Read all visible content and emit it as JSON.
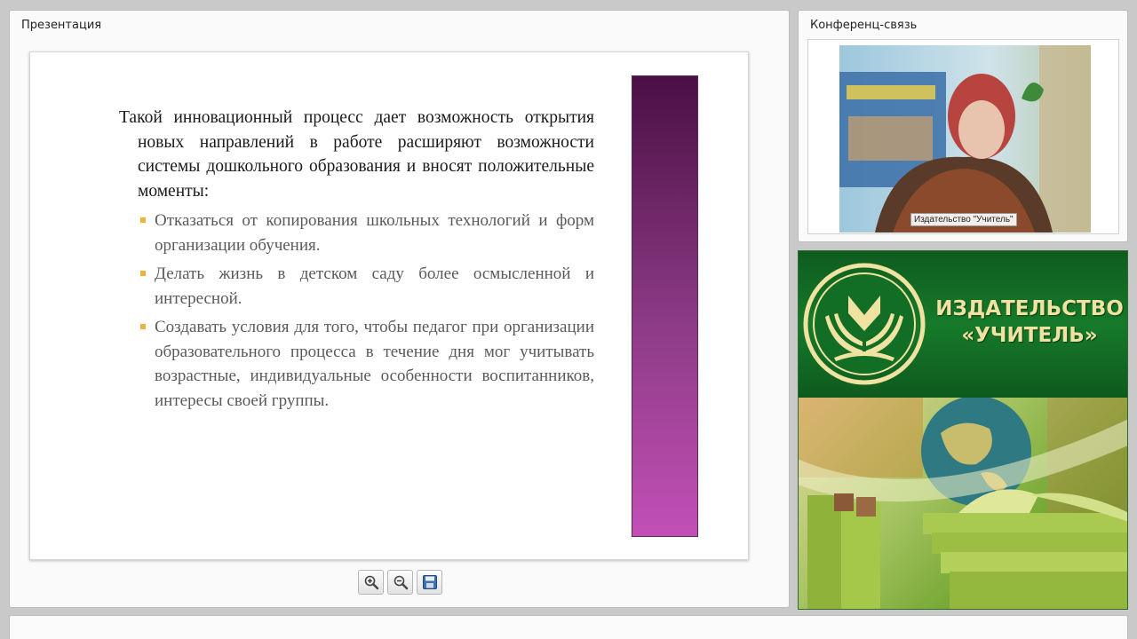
{
  "presentation": {
    "title": "Презентация",
    "slide": {
      "intro": "Такой инновационный процесс дает возможность открытия новых направлений в работе расширяют возможности системы дошкольного образования и вносят положительные моменты:",
      "bullets": [
        "Отказаться от копирования школьных технологий и форм организации обучения.",
        "Делать жизнь в детском саду более осмысленной и интересной.",
        "Создавать условия для того, чтобы педагог при организации образовательного процесса в течение дня мог учитывать возрастные, индивидуальные особенности воспитанников, интересы своей группы."
      ],
      "accent_bar_color": "#8e3c87",
      "bullet_color": "#f0b33a"
    },
    "toolbar": {
      "buttons": [
        "zoom-in-icon",
        "zoom-out-icon",
        "save-icon"
      ]
    }
  },
  "conference": {
    "title": "Конференц-связь",
    "participant_name": "Издательство \"Учитель\""
  },
  "banner": {
    "line1": "ИЗДАТЕЛЬСТВО",
    "line2": "«УЧИТЕЛЬ»",
    "brand_green": "#167a2a",
    "brand_gold": "#f0e2a0"
  }
}
